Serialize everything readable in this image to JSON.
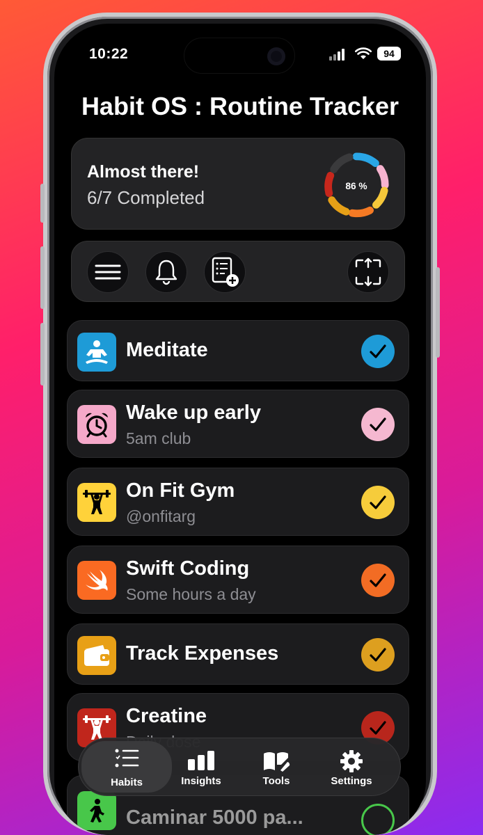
{
  "status": {
    "time": "10:22",
    "battery": "94"
  },
  "app": {
    "title": "Habit OS : Routine Tracker"
  },
  "summary": {
    "headline": "Almost there!",
    "completed": "6/7 Completed",
    "percent_label": "86 %",
    "percent": 0.86
  },
  "toolbar": {
    "buttons": [
      "menu-icon",
      "bell-icon",
      "add-note-icon",
      "share-screen-icon"
    ]
  },
  "habits": [
    {
      "name": "Meditate",
      "subtitle": "",
      "icon": "meditation-icon",
      "color": "#1e9bd7",
      "check_color": "#1e9bd7",
      "done": true
    },
    {
      "name": "Wake up early",
      "subtitle": "5am club",
      "icon": "alarm-clock-icon",
      "color": "#f5a8c9",
      "check_color": "#f5b8d0",
      "done": true
    },
    {
      "name": "On Fit Gym",
      "subtitle": "@onfitarg",
      "icon": "weightlifter-icon",
      "color": "#ffd23a",
      "check_color": "#f6cc3b",
      "done": true
    },
    {
      "name": "Swift Coding",
      "subtitle": "Some hours a day",
      "icon": "swift-icon",
      "color": "#fa6a22",
      "check_color": "#f26c24",
      "done": true
    },
    {
      "name": "Track Expenses",
      "subtitle": "",
      "icon": "wallet-icon",
      "color": "#e8a016",
      "check_color": "#dd9f1f",
      "done": true
    },
    {
      "name": "Creatine",
      "subtitle": "Daily dose",
      "icon": "weightlifter-icon",
      "color": "#c0261c",
      "check_color": "#b8261c",
      "done": true
    },
    {
      "name": "Caminar 5000 pa...",
      "subtitle": "",
      "icon": "walking-icon",
      "color": "#48c74a",
      "check_color": "#48c74a",
      "done": false
    }
  ],
  "tabbar": {
    "tabs": [
      {
        "label": "Habits",
        "icon": "checklist-icon",
        "active": true
      },
      {
        "label": "Insights",
        "icon": "bar-chart-icon",
        "active": false
      },
      {
        "label": "Tools",
        "icon": "tools-icon",
        "active": false
      },
      {
        "label": "Settings",
        "icon": "gear-icon",
        "active": false
      }
    ]
  }
}
